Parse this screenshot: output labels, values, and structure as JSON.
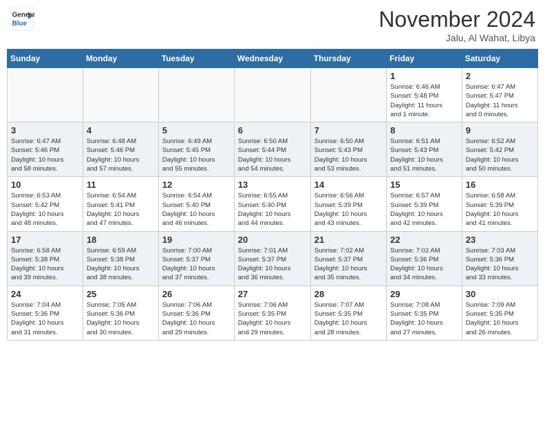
{
  "header": {
    "logo_line1": "General",
    "logo_line2": "Blue",
    "month": "November 2024",
    "location": "Jalu, Al Wahat, Libya"
  },
  "days_of_week": [
    "Sunday",
    "Monday",
    "Tuesday",
    "Wednesday",
    "Thursday",
    "Friday",
    "Saturday"
  ],
  "weeks": [
    [
      {
        "day": "",
        "info": ""
      },
      {
        "day": "",
        "info": ""
      },
      {
        "day": "",
        "info": ""
      },
      {
        "day": "",
        "info": ""
      },
      {
        "day": "",
        "info": ""
      },
      {
        "day": "1",
        "info": "Sunrise: 6:46 AM\nSunset: 5:48 PM\nDaylight: 11 hours\nand 1 minute."
      },
      {
        "day": "2",
        "info": "Sunrise: 6:47 AM\nSunset: 5:47 PM\nDaylight: 11 hours\nand 0 minutes."
      }
    ],
    [
      {
        "day": "3",
        "info": "Sunrise: 6:47 AM\nSunset: 5:46 PM\nDaylight: 10 hours\nand 58 minutes."
      },
      {
        "day": "4",
        "info": "Sunrise: 6:48 AM\nSunset: 5:46 PM\nDaylight: 10 hours\nand 57 minutes."
      },
      {
        "day": "5",
        "info": "Sunrise: 6:49 AM\nSunset: 5:45 PM\nDaylight: 10 hours\nand 55 minutes."
      },
      {
        "day": "6",
        "info": "Sunrise: 6:50 AM\nSunset: 5:44 PM\nDaylight: 10 hours\nand 54 minutes."
      },
      {
        "day": "7",
        "info": "Sunrise: 6:50 AM\nSunset: 5:43 PM\nDaylight: 10 hours\nand 53 minutes."
      },
      {
        "day": "8",
        "info": "Sunrise: 6:51 AM\nSunset: 5:43 PM\nDaylight: 10 hours\nand 51 minutes."
      },
      {
        "day": "9",
        "info": "Sunrise: 6:52 AM\nSunset: 5:42 PM\nDaylight: 10 hours\nand 50 minutes."
      }
    ],
    [
      {
        "day": "10",
        "info": "Sunrise: 6:53 AM\nSunset: 5:42 PM\nDaylight: 10 hours\nand 48 minutes."
      },
      {
        "day": "11",
        "info": "Sunrise: 6:54 AM\nSunset: 5:41 PM\nDaylight: 10 hours\nand 47 minutes."
      },
      {
        "day": "12",
        "info": "Sunrise: 6:54 AM\nSunset: 5:40 PM\nDaylight: 10 hours\nand 46 minutes."
      },
      {
        "day": "13",
        "info": "Sunrise: 6:55 AM\nSunset: 5:40 PM\nDaylight: 10 hours\nand 44 minutes."
      },
      {
        "day": "14",
        "info": "Sunrise: 6:56 AM\nSunset: 5:39 PM\nDaylight: 10 hours\nand 43 minutes."
      },
      {
        "day": "15",
        "info": "Sunrise: 6:57 AM\nSunset: 5:39 PM\nDaylight: 10 hours\nand 42 minutes."
      },
      {
        "day": "16",
        "info": "Sunrise: 6:58 AM\nSunset: 5:39 PM\nDaylight: 10 hours\nand 41 minutes."
      }
    ],
    [
      {
        "day": "17",
        "info": "Sunrise: 6:58 AM\nSunset: 5:38 PM\nDaylight: 10 hours\nand 39 minutes."
      },
      {
        "day": "18",
        "info": "Sunrise: 6:59 AM\nSunset: 5:38 PM\nDaylight: 10 hours\nand 38 minutes."
      },
      {
        "day": "19",
        "info": "Sunrise: 7:00 AM\nSunset: 5:37 PM\nDaylight: 10 hours\nand 37 minutes."
      },
      {
        "day": "20",
        "info": "Sunrise: 7:01 AM\nSunset: 5:37 PM\nDaylight: 10 hours\nand 36 minutes."
      },
      {
        "day": "21",
        "info": "Sunrise: 7:02 AM\nSunset: 5:37 PM\nDaylight: 10 hours\nand 35 minutes."
      },
      {
        "day": "22",
        "info": "Sunrise: 7:02 AM\nSunset: 5:36 PM\nDaylight: 10 hours\nand 34 minutes."
      },
      {
        "day": "23",
        "info": "Sunrise: 7:03 AM\nSunset: 5:36 PM\nDaylight: 10 hours\nand 33 minutes."
      }
    ],
    [
      {
        "day": "24",
        "info": "Sunrise: 7:04 AM\nSunset: 5:36 PM\nDaylight: 10 hours\nand 31 minutes."
      },
      {
        "day": "25",
        "info": "Sunrise: 7:05 AM\nSunset: 5:36 PM\nDaylight: 10 hours\nand 30 minutes."
      },
      {
        "day": "26",
        "info": "Sunrise: 7:06 AM\nSunset: 5:36 PM\nDaylight: 10 hours\nand 29 minutes."
      },
      {
        "day": "27",
        "info": "Sunrise: 7:06 AM\nSunset: 5:35 PM\nDaylight: 10 hours\nand 29 minutes."
      },
      {
        "day": "28",
        "info": "Sunrise: 7:07 AM\nSunset: 5:35 PM\nDaylight: 10 hours\nand 28 minutes."
      },
      {
        "day": "29",
        "info": "Sunrise: 7:08 AM\nSunset: 5:35 PM\nDaylight: 10 hours\nand 27 minutes."
      },
      {
        "day": "30",
        "info": "Sunrise: 7:09 AM\nSunset: 5:35 PM\nDaylight: 10 hours\nand 26 minutes."
      }
    ]
  ]
}
